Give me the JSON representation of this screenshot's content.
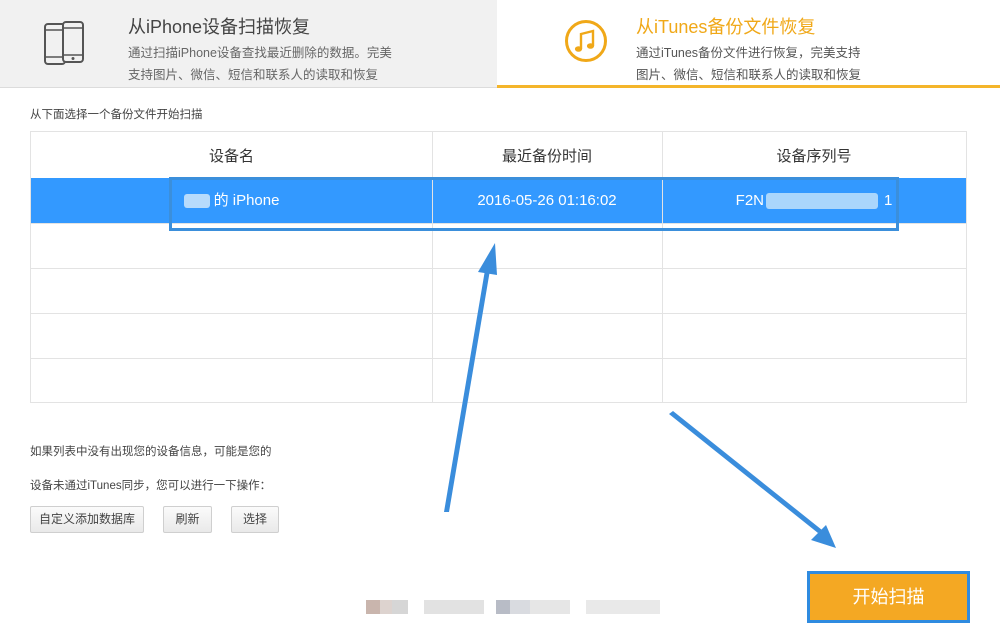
{
  "tabs": {
    "left": {
      "title": "从iPhone设备扫描恢复",
      "desc_line1": "通过扫描iPhone设备查找最近删除的数据。完美",
      "desc_line2": "支持图片、微信、短信和联系人的读取和恢复",
      "icon": "phone-icon"
    },
    "right": {
      "title": "从iTunes备份文件恢复",
      "desc_line1": "通过iTunes备份文件进行恢复，完美支持",
      "desc_line2": "图片、微信、短信和联系人的读取和恢复",
      "icon": "music-note-icon"
    }
  },
  "instruction": "从下面选择一个备份文件开始扫描",
  "table": {
    "headers": [
      "设备名",
      "最近备份时间",
      "设备序列号"
    ],
    "rows": [
      {
        "device_name": "的 iPhone",
        "backup_time": "2016-05-26  01:16:02",
        "serial_prefix": "F2N",
        "serial_suffix": "1"
      }
    ],
    "empty_rows": 4
  },
  "notes": {
    "line1": "如果列表中没有出现您的设备信息，可能是您的",
    "line2": "设备未通过iTunes同步，您可以进行一下操作："
  },
  "buttons": {
    "custom_db": "自定义添加数据库",
    "refresh": "刷新",
    "select": "选择",
    "start_scan": "开始扫描"
  },
  "colors": {
    "accent": "#f4b52a",
    "selected_row": "#3399ff",
    "annotation": "#3b8fdb"
  }
}
